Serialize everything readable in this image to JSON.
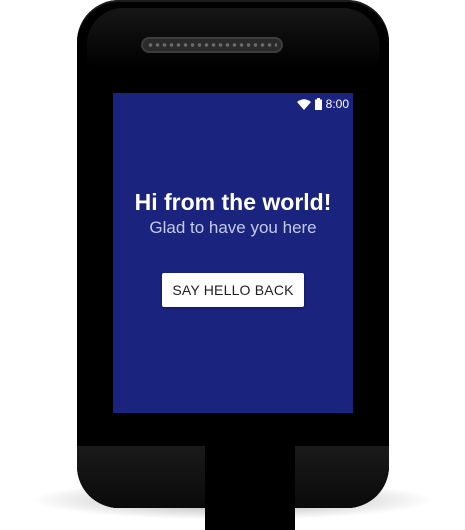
{
  "status_bar": {
    "time": "8:00",
    "icons": [
      "wifi-icon",
      "battery-icon"
    ]
  },
  "main": {
    "title": "Hi from the world!",
    "subtitle": "Glad to have you here",
    "button_label": "SAY HELLO BACK"
  },
  "colors": {
    "screen_background": "#1a237e",
    "title_text": "#ffffff",
    "subtitle_text": "#c5cae9",
    "button_background": "#ffffff",
    "button_text": "#212121",
    "device_body": "#000000"
  }
}
